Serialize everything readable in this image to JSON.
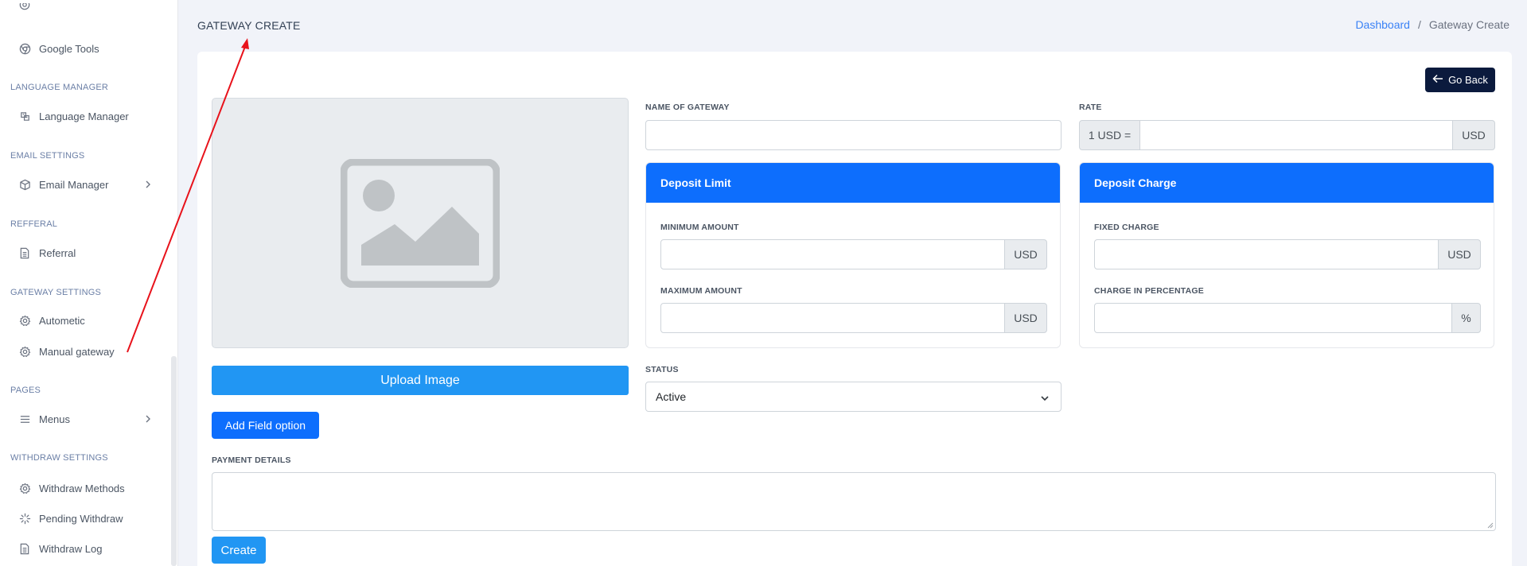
{
  "sidebar": {
    "top_item": {
      "label": "Google Tools",
      "icon": "chrome-icon"
    },
    "sections": [
      {
        "title": "LANGUAGE MANAGER",
        "items": [
          {
            "label": "Language Manager",
            "icon": "language-icon"
          }
        ]
      },
      {
        "title": "EMAIL SETTINGS",
        "items": [
          {
            "label": "Email Manager",
            "icon": "box-icon",
            "chevron": true
          }
        ]
      },
      {
        "title": "REFFERAL",
        "items": [
          {
            "label": "Referral",
            "icon": "document-icon"
          }
        ]
      },
      {
        "title": "GATEWAY SETTINGS",
        "items": [
          {
            "label": "Autometic",
            "icon": "gear-icon"
          },
          {
            "label": "Manual gateway",
            "icon": "gear-icon"
          }
        ]
      },
      {
        "title": "PAGES",
        "items": [
          {
            "label": "Menus",
            "icon": "menu-icon",
            "chevron": true
          }
        ]
      },
      {
        "title": "WITHDRAW SETTINGS",
        "items": [
          {
            "label": "Withdraw Methods",
            "icon": "gear-icon"
          },
          {
            "label": "Pending Withdraw",
            "icon": "loader-icon"
          },
          {
            "label": "Withdraw Log",
            "icon": "document-icon"
          }
        ]
      }
    ]
  },
  "header": {
    "title": "GATEWAY CREATE",
    "breadcrumb": {
      "home": "Dashboard",
      "separator": "/",
      "current": "Gateway Create"
    }
  },
  "form": {
    "go_back": "Go Back",
    "upload_button": "Upload Image",
    "add_field_button": "Add Field option",
    "name_label": "NAME OF GATEWAY",
    "name_value": "",
    "rate_label": "RATE",
    "rate_prefix": "1 USD =",
    "rate_suffix": "USD",
    "rate_value": "",
    "deposit_limit": {
      "title": "Deposit Limit",
      "min_label": "MINIMUM AMOUNT",
      "min_suffix": "USD",
      "max_label": "MAXIMUM AMOUNT",
      "max_suffix": "USD"
    },
    "deposit_charge": {
      "title": "Deposit Charge",
      "fixed_label": "FIXED CHARGE",
      "fixed_suffix": "USD",
      "percent_label": "CHARGE IN PERCENTAGE",
      "percent_suffix": "%"
    },
    "status_label": "STATUS",
    "status_value": "Active",
    "payment_details_label": "PAYMENT DETAILS",
    "create_button": "Create"
  },
  "colors": {
    "primary": "#0d6efd",
    "upload": "#2196f3",
    "go_back_bg": "#0b1a3d",
    "annotation_arrow": "#e8121b"
  }
}
